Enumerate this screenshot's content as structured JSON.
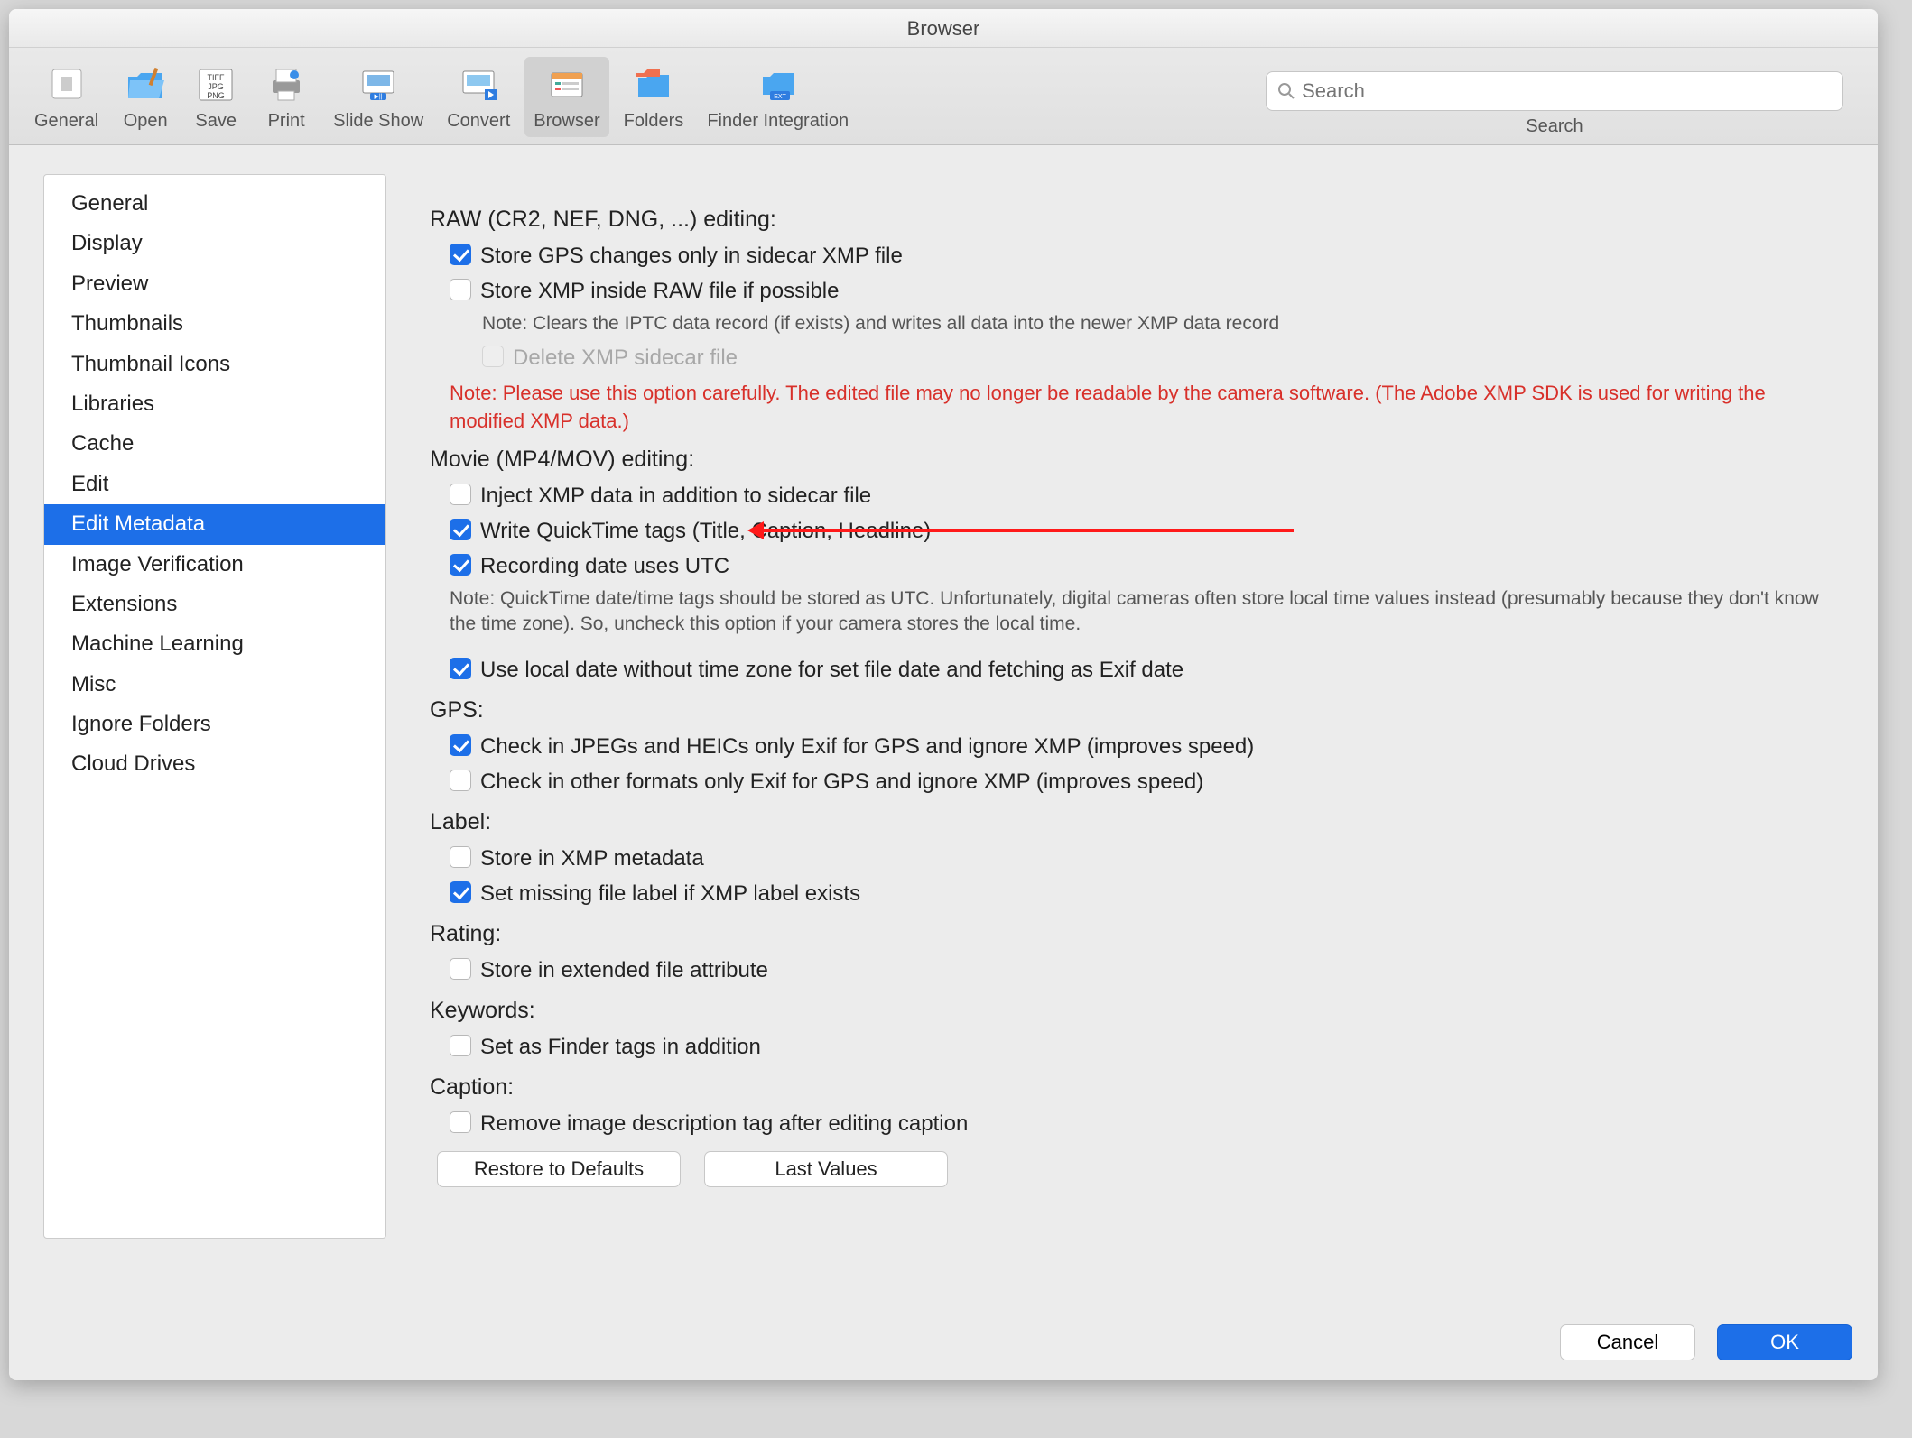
{
  "window": {
    "title": "Browser"
  },
  "toolbar": {
    "items": [
      {
        "label": "General"
      },
      {
        "label": "Open"
      },
      {
        "label": "Save"
      },
      {
        "label": "Print"
      },
      {
        "label": "Slide Show"
      },
      {
        "label": "Convert"
      },
      {
        "label": "Browser"
      },
      {
        "label": "Folders"
      },
      {
        "label": "Finder Integration"
      }
    ],
    "search_placeholder": "Search",
    "search_label": "Search"
  },
  "sidebar": {
    "items": [
      "General",
      "Display",
      "Preview",
      "Thumbnails",
      "Thumbnail Icons",
      "Libraries",
      "Cache",
      "Edit",
      "Edit Metadata",
      "Image Verification",
      "Extensions",
      "Machine Learning",
      "Misc",
      "Ignore Folders",
      "Cloud Drives"
    ],
    "selected": "Edit Metadata"
  },
  "content": {
    "raw_title": "RAW (CR2, NEF, DNG, ...) editing:",
    "raw_opts": {
      "store_gps_sidecar": "Store GPS changes only in sidecar XMP file",
      "store_xmp_inside": "Store XMP inside RAW file if possible",
      "store_xmp_note": "Note: Clears the IPTC data record (if exists) and writes all data into the newer XMP data record",
      "delete_xmp": "Delete XMP sidecar file",
      "warning": "Note: Please use this option carefully. The edited file may no longer be readable by the camera software. (The Adobe XMP SDK is used for writing the modified XMP data.)"
    },
    "movie_title": "Movie (MP4/MOV) editing:",
    "movie_opts": {
      "inject_xmp": "Inject XMP data in addition to sidecar file",
      "write_qt": "Write QuickTime tags (Title, Caption, Headline)",
      "rec_utc": "Recording date uses UTC",
      "qt_note": "Note: QuickTime date/time tags should be stored as UTC. Unfortunately, digital cameras often store local time values instead (presumably because they don't know the time zone). So, uncheck this option if your camera stores the local time."
    },
    "use_local_date": "Use local date without time zone for set file date and fetching as Exif date",
    "gps_title": "GPS:",
    "gps_opts": {
      "jpeg_heic": "Check in JPEGs and HEICs only Exif for GPS and ignore XMP (improves speed)",
      "other_formats": "Check in other formats only Exif for GPS and ignore XMP (improves speed)"
    },
    "label_title": "Label:",
    "label_opts": {
      "store_xmp": "Store in XMP metadata",
      "set_missing": "Set missing file label if XMP label exists"
    },
    "rating_title": "Rating:",
    "rating_opts": {
      "extended_attr": "Store in extended file attribute"
    },
    "keywords_title": "Keywords:",
    "keywords_opts": {
      "finder_tags": "Set as Finder tags in addition"
    },
    "caption_title": "Caption:",
    "caption_opts": {
      "remove_desc": "Remove image description tag after editing caption"
    },
    "restore_btn": "Restore to Defaults",
    "last_values_btn": "Last Values"
  },
  "footer": {
    "cancel": "Cancel",
    "ok": "OK"
  }
}
